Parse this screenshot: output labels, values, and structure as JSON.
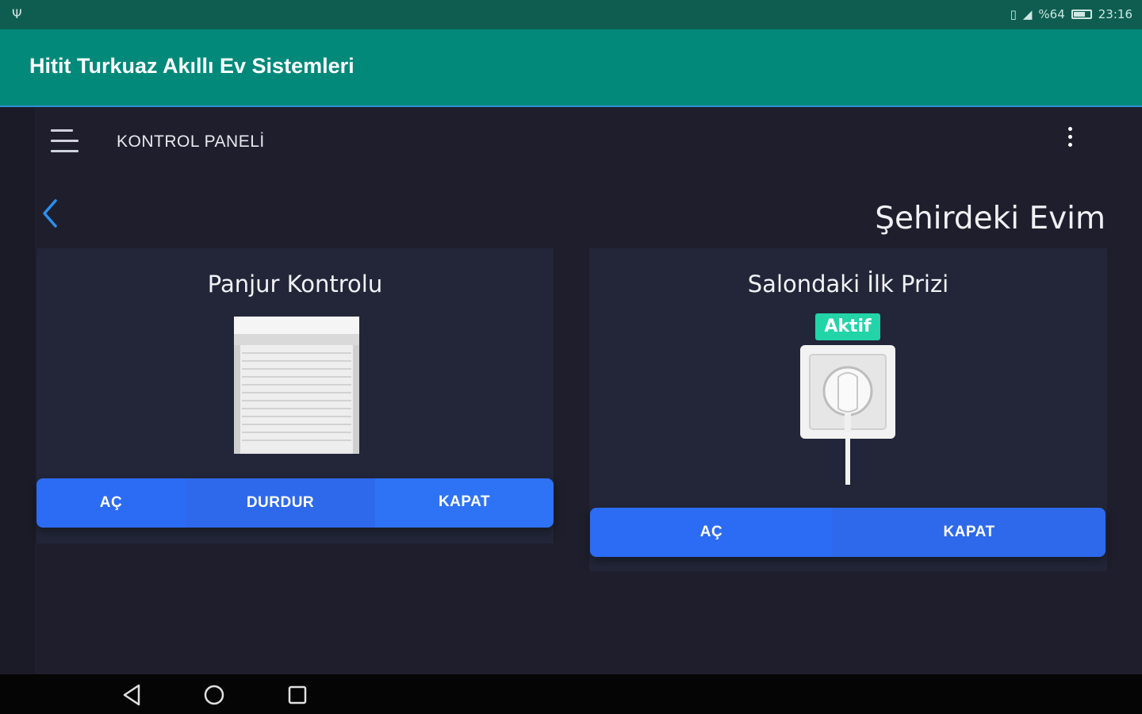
{
  "status_bar": {
    "usb_icon": "usb-icon",
    "vibrate_icon": "vibrate-icon",
    "signal_icon": "signal-icon",
    "battery_text": "%64",
    "time": "23:16"
  },
  "app_bar": {
    "title": "Hitit Turkuaz Akıllı Ev Sistemleri"
  },
  "toolbar": {
    "menu_icon": "hamburger-menu-icon",
    "title": "KONTROL PANELİ",
    "overflow_icon": "more-vertical-icon"
  },
  "page": {
    "back_icon": "chevron-left-icon",
    "home_name": "Şehirdeki Evim"
  },
  "cards": [
    {
      "title": "Panjur Kontrolu",
      "image": "roller-shutter-image",
      "buttons": [
        "AÇ",
        "DURDUR",
        "KAPAT"
      ]
    },
    {
      "title": "Salondaki İlk Prizi",
      "status_badge": "Aktif",
      "image": "power-socket-image",
      "buttons": [
        "AÇ",
        "KAPAT"
      ]
    }
  ],
  "colors": {
    "status_bar": "#0e5d50",
    "app_bar": "#02897a",
    "background": "#1e1e2c",
    "card": "#222638",
    "button": "#2c6cf4",
    "badge": "#22d4a8",
    "back_arrow": "#2a8ff0"
  },
  "nav_bar": {
    "back_icon": "nav-back-triangle-icon",
    "home_icon": "nav-home-circle-icon",
    "recents_icon": "nav-recents-square-icon"
  }
}
